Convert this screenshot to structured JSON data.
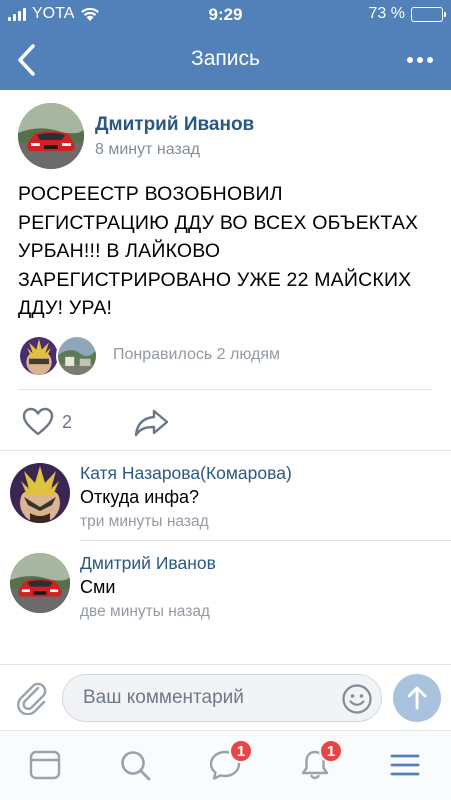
{
  "status_bar": {
    "carrier": "YOTA",
    "time": "9:29",
    "battery": "73 %",
    "battery_level": 0.73
  },
  "nav": {
    "title": "Запись",
    "back_icon": "chevron-left-icon",
    "more_icon": "more-dots-icon"
  },
  "post": {
    "author": "Дмитрий Иванов",
    "time": "8 минут назад",
    "text": "РОСРЕЕСТР ВОЗОБНОВИЛ РЕГИСТРАЦИЮ ДДУ ВО ВСЕХ ОБЪЕКТАХ УРБАН!!! В ЛАЙКОВО ЗАРЕГИСТРИРОВАНО УЖЕ 22 МАЙСКИХ ДДУ! УРА!",
    "likes_text": "Понравилось 2 людям",
    "like_count": "2"
  },
  "comments": [
    {
      "author": "Катя Назарова(Комарова)",
      "text": "Откуда инфа?",
      "time": "три минуты назад"
    },
    {
      "author": "Дмитрий Иванов",
      "text": "Сми",
      "time": "две минуты назад"
    }
  ],
  "composer": {
    "placeholder": "Ваш комментарий"
  },
  "tabs": [
    {
      "icon": "news-feed-icon",
      "badge": ""
    },
    {
      "icon": "search-icon",
      "badge": ""
    },
    {
      "icon": "messages-icon",
      "badge": "1"
    },
    {
      "icon": "notifications-icon",
      "badge": "1"
    },
    {
      "icon": "menu-icon",
      "badge": ""
    }
  ],
  "colors": {
    "header_blue": "#5181b8",
    "link_blue": "#2a5885",
    "secondary_gray": "#818c99",
    "badge_red": "#e64646",
    "send_button": "#a9c3df"
  }
}
